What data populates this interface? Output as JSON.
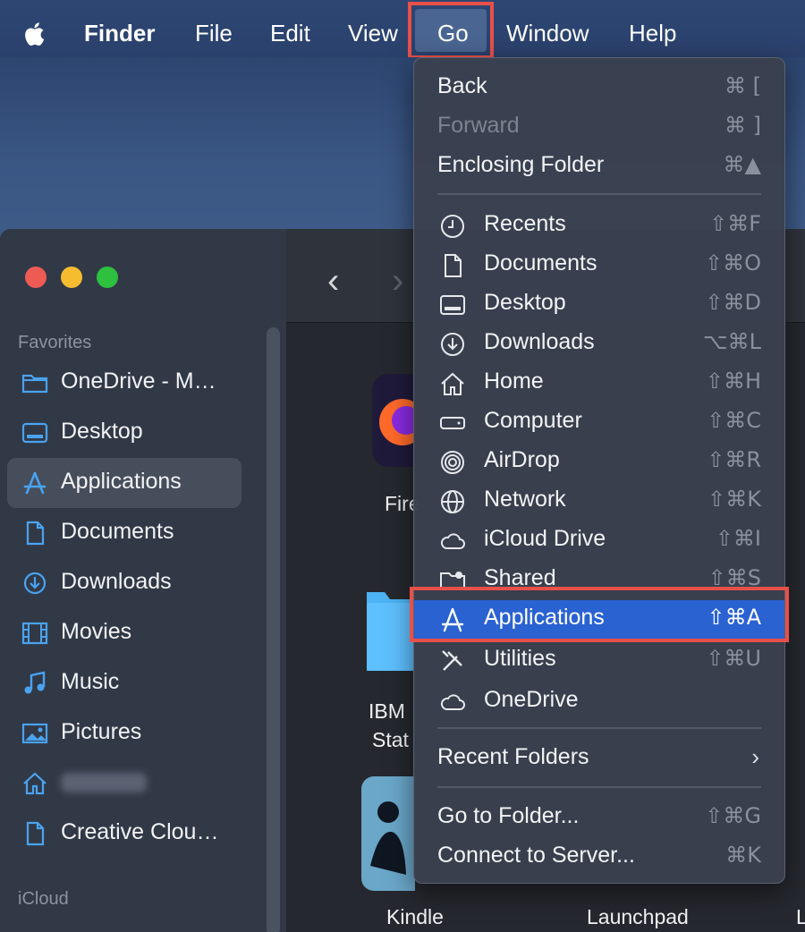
{
  "menubar": {
    "app_name": "Finder",
    "items": [
      "File",
      "Edit",
      "View",
      "Go",
      "Window",
      "Help"
    ]
  },
  "sidebar": {
    "sections": {
      "favorites": "Favorites",
      "icloud": "iCloud"
    },
    "items": [
      {
        "label": "OneDrive - M…",
        "icon": "folder-icon"
      },
      {
        "label": "Desktop",
        "icon": "desktop-icon"
      },
      {
        "label": "Applications",
        "icon": "applications-icon",
        "selected": true
      },
      {
        "label": "Documents",
        "icon": "document-icon"
      },
      {
        "label": "Downloads",
        "icon": "downloads-icon"
      },
      {
        "label": "Movies",
        "icon": "film-icon"
      },
      {
        "label": "Music",
        "icon": "music-icon"
      },
      {
        "label": "Pictures",
        "icon": "pictures-icon"
      },
      {
        "label": "",
        "icon": "home-icon"
      },
      {
        "label": "Creative Clou…",
        "icon": "document-icon"
      }
    ]
  },
  "content": {
    "apps": [
      "Fire",
      "IBM",
      "Stat",
      "Kindle",
      "Launchpad",
      "L"
    ]
  },
  "go_menu": {
    "items": {
      "back": {
        "label": "Back",
        "shortcut": "⌘ ["
      },
      "forward": {
        "label": "Forward",
        "shortcut": "⌘ ]"
      },
      "enclosing": {
        "label": "Enclosing Folder",
        "shortcut": "⌘▲"
      },
      "recents": {
        "label": "Recents",
        "shortcut": "⇧⌘F"
      },
      "documents": {
        "label": "Documents",
        "shortcut": "⇧⌘O"
      },
      "desktop": {
        "label": "Desktop",
        "shortcut": "⇧⌘D"
      },
      "downloads": {
        "label": "Downloads",
        "shortcut": "⌥⌘L"
      },
      "home": {
        "label": "Home",
        "shortcut": "⇧⌘H"
      },
      "computer": {
        "label": "Computer",
        "shortcut": "⇧⌘C"
      },
      "airdrop": {
        "label": "AirDrop",
        "shortcut": "⇧⌘R"
      },
      "network": {
        "label": "Network",
        "shortcut": "⇧⌘K"
      },
      "icloud": {
        "label": "iCloud Drive",
        "shortcut": "⇧⌘I"
      },
      "shared": {
        "label": "Shared",
        "shortcut": "⇧⌘S"
      },
      "applications": {
        "label": "Applications",
        "shortcut": "⇧⌘A"
      },
      "utilities": {
        "label": "Utilities",
        "shortcut": "⇧⌘U"
      },
      "onedrive": {
        "label": "OneDrive",
        "shortcut": ""
      },
      "recent_folders": {
        "label": "Recent Folders",
        "shortcut": ""
      },
      "go_to_folder": {
        "label": "Go to Folder...",
        "shortcut": "⇧⌘G"
      },
      "connect": {
        "label": "Connect to Server...",
        "shortcut": "⌘K"
      }
    }
  },
  "colors": {
    "highlight": "#2a62d1",
    "annotation": "#e8504a"
  }
}
